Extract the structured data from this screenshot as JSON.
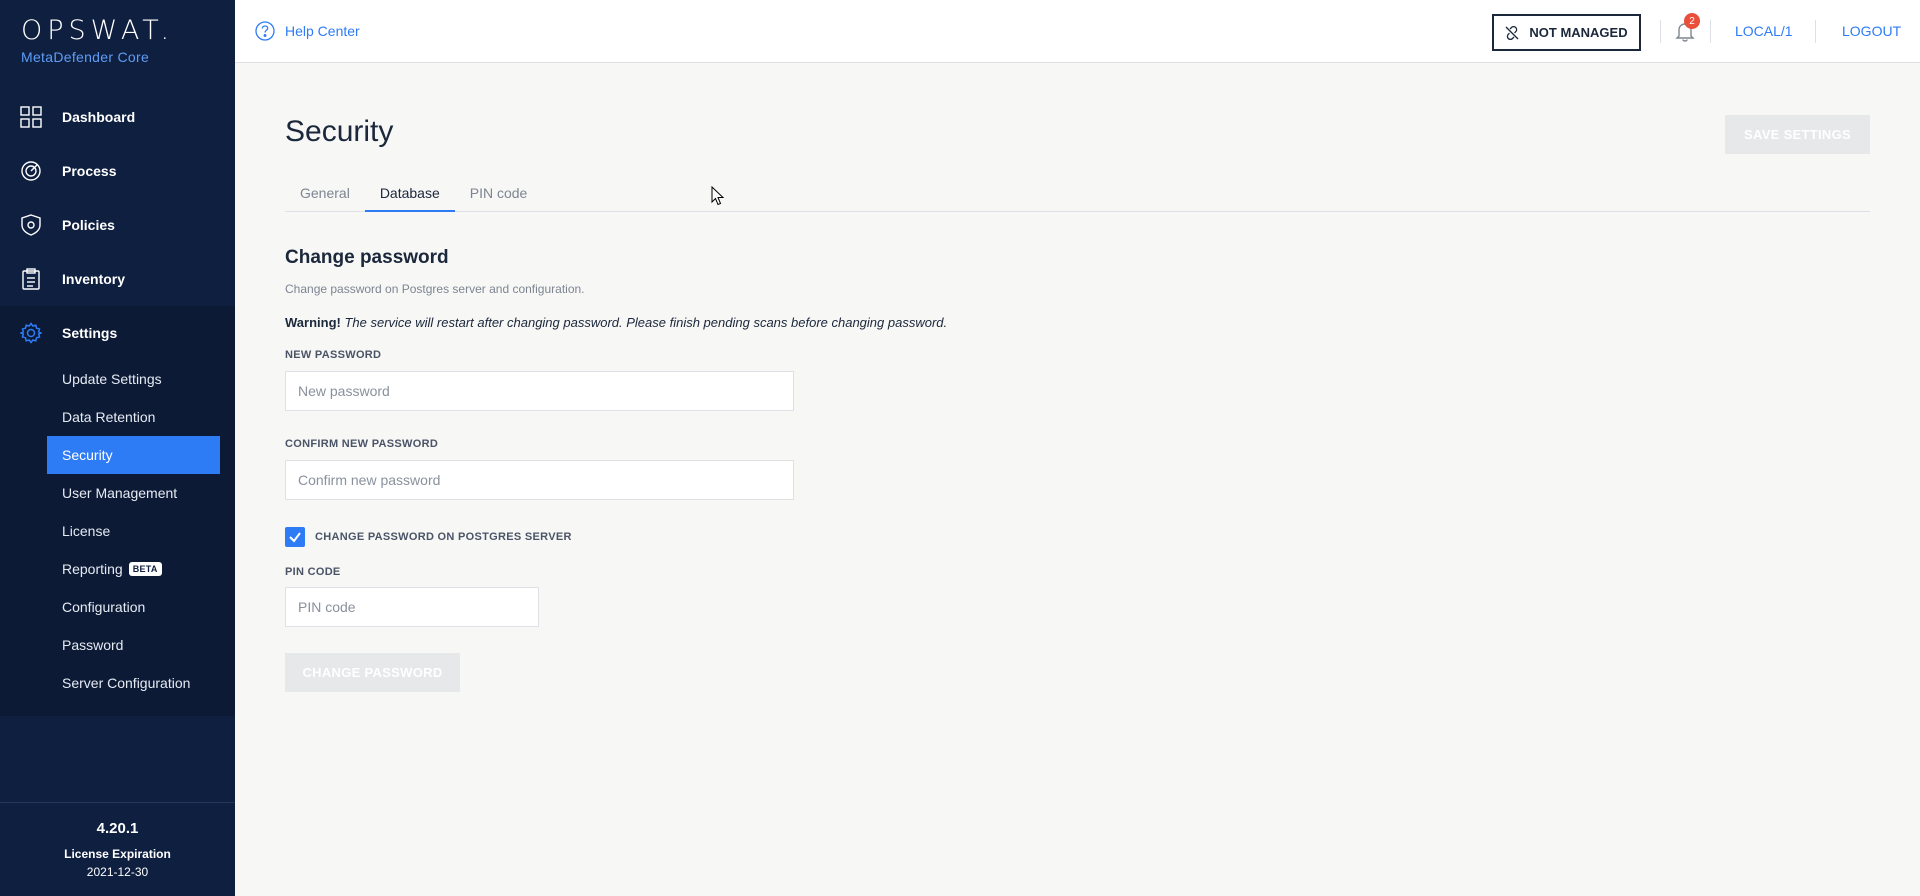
{
  "sidebar": {
    "logo": "OPSWAT.",
    "product": "MetaDefender Core",
    "nav": [
      {
        "label": "Dashboard",
        "icon": "dashboard-icon"
      },
      {
        "label": "Process",
        "icon": "process-icon"
      },
      {
        "label": "Policies",
        "icon": "policies-icon"
      },
      {
        "label": "Inventory",
        "icon": "inventory-icon"
      },
      {
        "label": "Settings",
        "icon": "settings-icon"
      }
    ],
    "settings_items": [
      {
        "label": "Update Settings"
      },
      {
        "label": "Data Retention"
      },
      {
        "label": "Security"
      },
      {
        "label": "User Management"
      },
      {
        "label": "License"
      },
      {
        "label": "Reporting",
        "badge": "BETA"
      },
      {
        "label": "Configuration"
      },
      {
        "label": "Password"
      },
      {
        "label": "Server Configuration"
      }
    ],
    "footer": {
      "version": "4.20.1",
      "license_label": "License Expiration",
      "license_date": "2021-12-30"
    }
  },
  "topbar": {
    "help": "Help Center",
    "not_managed": "NOT MANAGED",
    "notifications_count": "2",
    "user": "LOCAL/1",
    "logout": "LOGOUT"
  },
  "main": {
    "title": "Security",
    "save_settings": "SAVE SETTINGS",
    "tabs": [
      {
        "label": "General"
      },
      {
        "label": "Database"
      },
      {
        "label": "PIN code"
      }
    ],
    "section_title": "Change password",
    "section_desc": "Change password on Postgres server and configuration.",
    "warning_bold": "Warning!",
    "warning_text": " The service will restart after changing password. Please finish pending scans before changing password.",
    "new_password": {
      "label": "NEW PASSWORD",
      "placeholder": "New password",
      "value": ""
    },
    "confirm_password": {
      "label": "CONFIRM NEW PASSWORD",
      "placeholder": "Confirm new password",
      "value": ""
    },
    "checkbox": {
      "label": "CHANGE PASSWORD ON POSTGRES SERVER",
      "checked": true
    },
    "pin": {
      "label": "PIN CODE",
      "placeholder": "PIN code",
      "value": ""
    },
    "change_password_button": "CHANGE PASSWORD"
  },
  "colors": {
    "sidebar_bg": "#0f1f40",
    "accent": "#2e7bf6",
    "badge": "#e94f3b",
    "disabled_button": "#e6e8ea"
  }
}
